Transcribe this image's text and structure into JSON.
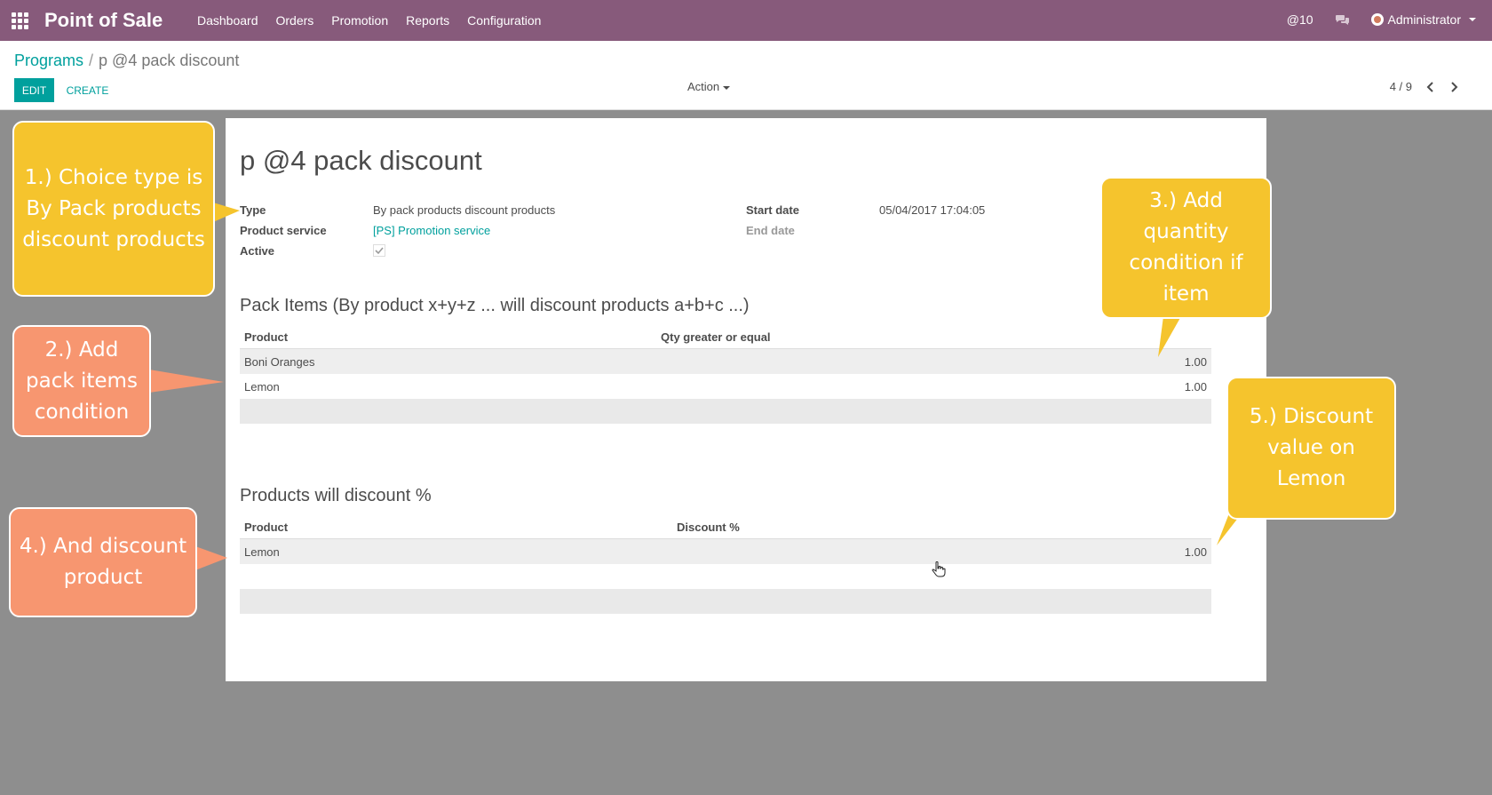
{
  "app": {
    "brand": "Point of Sale",
    "menu": [
      "Dashboard",
      "Orders",
      "Promotion",
      "Reports",
      "Configuration"
    ],
    "mentions": "@10",
    "user": "Administrator"
  },
  "control": {
    "breadcrumb_parent": "Programs",
    "breadcrumb_separator": "/",
    "breadcrumb_current": "p @4 pack discount",
    "edit_label": "EDIT",
    "create_label": "CREATE",
    "action_label": "Action",
    "pager": "4 / 9"
  },
  "record": {
    "title": "p @4 pack discount",
    "type_label": "Type",
    "type_value": "By pack products discount products",
    "product_service_label": "Product service",
    "product_service_value": "[PS] Promotion service",
    "active_label": "Active",
    "active_checked": true,
    "start_date_label": "Start date",
    "start_date_value": "05/04/2017 17:04:05",
    "end_date_label": "End date"
  },
  "pack_items": {
    "title": "Pack Items (By product x+y+z ... will discount products a+b+c ...)",
    "col_product": "Product",
    "col_qty": "Qty greater or equal",
    "rows": [
      {
        "product": "Boni Oranges",
        "qty": "1.00"
      },
      {
        "product": "Lemon",
        "qty": "1.00"
      }
    ]
  },
  "discount_products": {
    "title": "Products will discount %",
    "col_product": "Product",
    "col_discount": "Discount %",
    "rows": [
      {
        "product": "Lemon",
        "discount": "1.00"
      }
    ]
  },
  "callouts": {
    "c1": "1.) Choice type is By Pack products discount products",
    "c2": "2.) Add pack items condition",
    "c3": "3.) Add quantity condition if item",
    "c4": "4.) And discount product",
    "c5": "5.) Discount value on Lemon"
  },
  "colors": {
    "topbar": "#875a7b",
    "accent": "#00a09d",
    "callout_yellow": "#f5c42d",
    "callout_orange": "#f79670",
    "backdrop": "#8e8e8e"
  }
}
